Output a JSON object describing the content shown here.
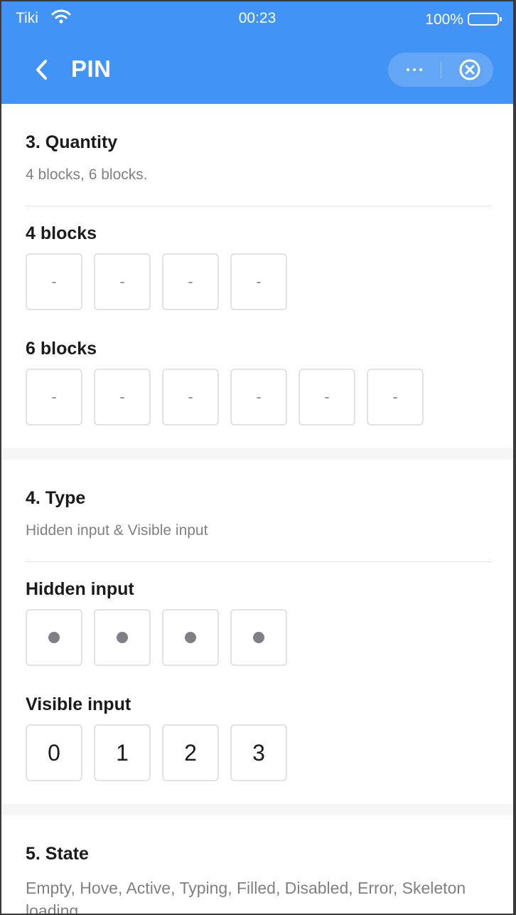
{
  "status_bar": {
    "carrier": "Tiki",
    "time": "00:23",
    "battery": "100%"
  },
  "nav": {
    "title": "PIN"
  },
  "sections": {
    "quantity": {
      "title": "3. Quantity",
      "description": "4 blocks, 6 blocks.",
      "four": {
        "label": "4 blocks",
        "blocks": [
          "-",
          "-",
          "-",
          "-"
        ]
      },
      "six": {
        "label": "6 blocks",
        "blocks": [
          "-",
          "-",
          "-",
          "-",
          "-",
          "-"
        ]
      }
    },
    "type": {
      "title": "4. Type",
      "description": "Hidden input & Visible input",
      "hidden": {
        "label": "Hidden input",
        "count": 4
      },
      "visible": {
        "label": "Visible input",
        "blocks": [
          "0",
          "1",
          "2",
          "3"
        ]
      }
    },
    "state": {
      "title": "5. State",
      "description": "Empty, Hove, Active, Typing, Filled, Disabled, Error, Skeleton loading"
    }
  },
  "colors": {
    "header": "#4193f5",
    "dot": "#7f7f85",
    "border": "#e2e2e2"
  },
  "icons": {
    "back": "chevron-left-icon",
    "more": "more-dots-icon",
    "close": "close-circle-icon",
    "wifi": "wifi-icon",
    "battery": "battery-icon"
  }
}
